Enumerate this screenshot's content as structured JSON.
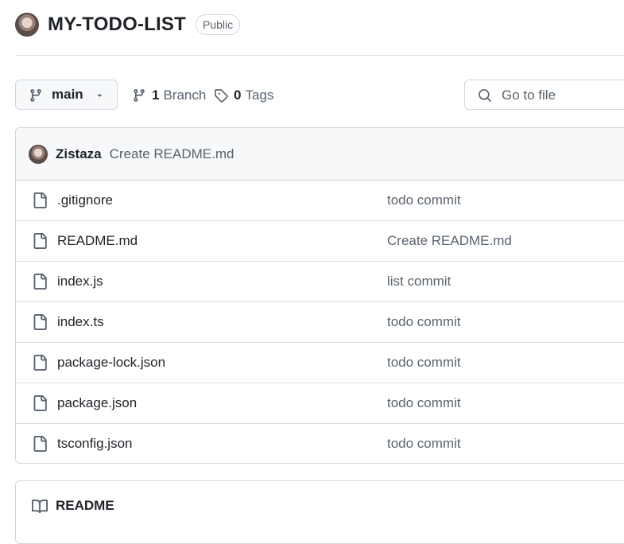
{
  "repo": {
    "name": "MY-TODO-LIST",
    "visibility": "Public",
    "avatar": "user-avatar"
  },
  "toolbar": {
    "branch": "main",
    "branch_count": "1",
    "branch_label": "Branch",
    "tag_count": "0",
    "tag_label": "Tags",
    "search_placeholder": "Go to file"
  },
  "latest_commit": {
    "author": "Zistaza",
    "message": "Create README.md"
  },
  "files": [
    {
      "name": ".gitignore",
      "commit": "todo commit",
      "icon": "file-icon"
    },
    {
      "name": "README.md",
      "commit": "Create README.md",
      "icon": "file-icon"
    },
    {
      "name": "index.js",
      "commit": "list commit",
      "icon": "file-icon"
    },
    {
      "name": "index.ts",
      "commit": "todo commit",
      "icon": "file-icon"
    },
    {
      "name": "package-lock.json",
      "commit": "todo commit",
      "icon": "file-icon"
    },
    {
      "name": "package.json",
      "commit": "todo commit",
      "icon": "file-icon"
    },
    {
      "name": "tsconfig.json",
      "commit": "todo commit",
      "icon": "file-icon"
    }
  ],
  "readme": {
    "title": "README",
    "icon": "book-icon"
  },
  "colors": {
    "text": "#1f2328",
    "muted": "#59636e",
    "border": "#d0d7de",
    "subtle_bg": "#f6f8fa"
  }
}
